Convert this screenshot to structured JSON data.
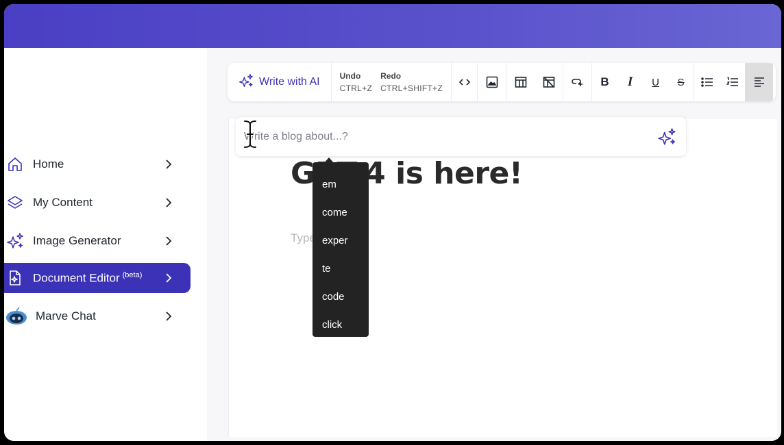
{
  "sidebar": {
    "items": [
      {
        "label": "Home",
        "icon": "home-icon"
      },
      {
        "label": "My Content",
        "icon": "layers-icon"
      },
      {
        "label": "Image Generator",
        "icon": "sparkles-icon"
      },
      {
        "label": "Document Editor",
        "badge": "(beta)",
        "icon": "ai-document-icon",
        "active": true
      },
      {
        "label": "Marve Chat",
        "icon": "robot-avatar-icon"
      }
    ]
  },
  "toolbar": {
    "write_ai_label": "Write with AI",
    "undo_label": "Undo",
    "undo_shortcut": "CTRL+Z",
    "redo_label": "Redo",
    "redo_shortcut": "CTRL+SHIFT+Z",
    "format_buttons": [
      "code-icon",
      "image-icon",
      "table-icon",
      "delete-table-icon",
      "link-icon",
      "bold-icon",
      "italic-icon",
      "underline-icon",
      "strikethrough-icon",
      "bullet-list-icon",
      "numbered-list-icon",
      "align-left-icon"
    ],
    "bold": "B",
    "italic": "I",
    "underline": "U",
    "strike": "S"
  },
  "prompt": {
    "placeholder": "Write a blog about...?"
  },
  "document": {
    "headline": "GPT-4 is here!",
    "body_placeholder": "Type"
  },
  "autocomplete": {
    "options": [
      "em",
      "come",
      "exper",
      "te",
      "code",
      "click"
    ]
  },
  "colors": {
    "accent": "#3b32b8",
    "header_gradient_start": "#4a3fc4",
    "header_gradient_end": "#6a66d4",
    "dropdown_bg": "#232323"
  }
}
